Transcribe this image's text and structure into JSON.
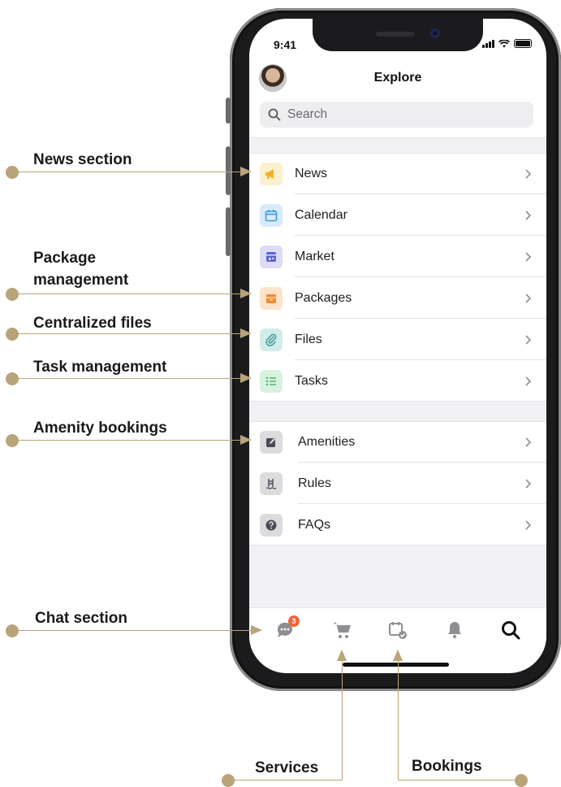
{
  "status_bar": {
    "time": "9:41"
  },
  "header": {
    "title": "Explore"
  },
  "search": {
    "placeholder": "Search"
  },
  "menu_group_1": [
    {
      "label": "News",
      "icon": "megaphone-icon",
      "color": "#f5b323",
      "bg": "#fdf0cf"
    },
    {
      "label": "Calendar",
      "icon": "calendar-icon",
      "color": "#3a9be6",
      "bg": "#d9ebfa"
    },
    {
      "label": "Market",
      "icon": "store-icon",
      "color": "#5b63d6",
      "bg": "#dcdcf6"
    },
    {
      "label": "Packages",
      "icon": "package-icon",
      "color": "#f08a2c",
      "bg": "#fde3c9"
    },
    {
      "label": "Files",
      "icon": "paperclip-icon",
      "color": "#3b9a95",
      "bg": "#d2ecea"
    },
    {
      "label": "Tasks",
      "icon": "list-icon",
      "color": "#42b56b",
      "bg": "#d9f2df"
    }
  ],
  "menu_group_2": [
    {
      "label": "Amenities",
      "icon": "edit-icon",
      "color": "#4b4b55",
      "bg": "#dcdcdf"
    },
    {
      "label": "Rules",
      "icon": "pool-ladder-icon",
      "color": "#4b4b55",
      "bg": "#dcdcdf"
    },
    {
      "label": "FAQs",
      "icon": "question-icon",
      "color": "#4b4b55",
      "bg": "#dcdcdf"
    }
  ],
  "tab_bar": {
    "chat_badge": "3",
    "tabs": [
      "chat-icon",
      "cart-icon",
      "calendar-check-icon",
      "bell-icon",
      "search-icon"
    ]
  },
  "annotations": {
    "news": "News section",
    "packages_line1": "Package",
    "packages_line2": "management",
    "files": "Centralized files",
    "tasks": "Task management",
    "amenities": "Amenity bookings",
    "chat": "Chat section",
    "services": "Services",
    "bookings": "Bookings"
  },
  "accent_color": "#b9a479"
}
